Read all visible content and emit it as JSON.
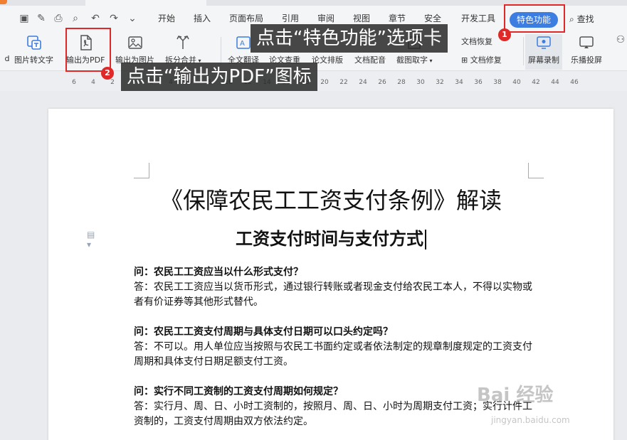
{
  "menu": {
    "tabs": [
      "开始",
      "插入",
      "页面布局",
      "引用",
      "审阅",
      "视图",
      "章节",
      "安全",
      "开发工具"
    ],
    "active_tab": "特色功能",
    "search": "查找",
    "accent_color": "#3b7de0"
  },
  "toolbar": {
    "items": [
      {
        "label": "d"
      },
      {
        "label": "图片转文字"
      },
      {
        "label": "输出为PDF"
      },
      {
        "label": "输出为图片"
      },
      {
        "label": "拆分合并"
      },
      {
        "label": "全文翻译"
      },
      {
        "label": "论文查重"
      },
      {
        "label": "论文排版"
      },
      {
        "label": "文档配音"
      },
      {
        "label": "截图取字"
      },
      {
        "label": "文档修复"
      },
      {
        "label": "屏幕录制"
      },
      {
        "label": "乐播投屏"
      }
    ],
    "partial_label": "文档恢复"
  },
  "ruler": {
    "numbers": [
      "6",
      "4",
      "2",
      "2",
      "4",
      "6",
      "8",
      "10",
      "12",
      "14",
      "16",
      "18",
      "20",
      "22",
      "24",
      "26",
      "28",
      "30",
      "32",
      "34",
      "36",
      "38",
      "40",
      "42",
      "44",
      "46"
    ]
  },
  "document": {
    "title": "《保障农民工工资支付条例》解读",
    "subtitle": "工资支付时间与支付方式",
    "qa": [
      {
        "q": "问：农民工工资应当以什么形式支付？",
        "a": "答：农民工工资应当以货币形式，通过银行转账或者现金支付给农民工本人，不得以实物或者有价证券等其他形式替代。"
      },
      {
        "q": "问：农民工工资支付周期与具体支付日期可以口头约定吗？",
        "a": "答：不可以。用人单位应当按照与农民工书面约定或者依法制定的规章制度规定的工资支付周期和具体支付日期足额支付工资。"
      },
      {
        "q": "问：实行不同工资制的工资支付周期如何规定？",
        "a": "答：实行月、周、日、小时工资制的，按照月、周、日、小时为周期支付工资；实行计件工资制的，工资支付周期由双方依法约定。"
      }
    ]
  },
  "annotations": {
    "step1_badge": "1",
    "step1_text": "点击“特色功能”选项卡",
    "step2_badge": "2",
    "step2_text": "点击“输出为PDF”图标",
    "highlight_color": "#e02828"
  },
  "watermark": {
    "brand": "Bai 经验",
    "url": "jingyan.baidu.com"
  }
}
